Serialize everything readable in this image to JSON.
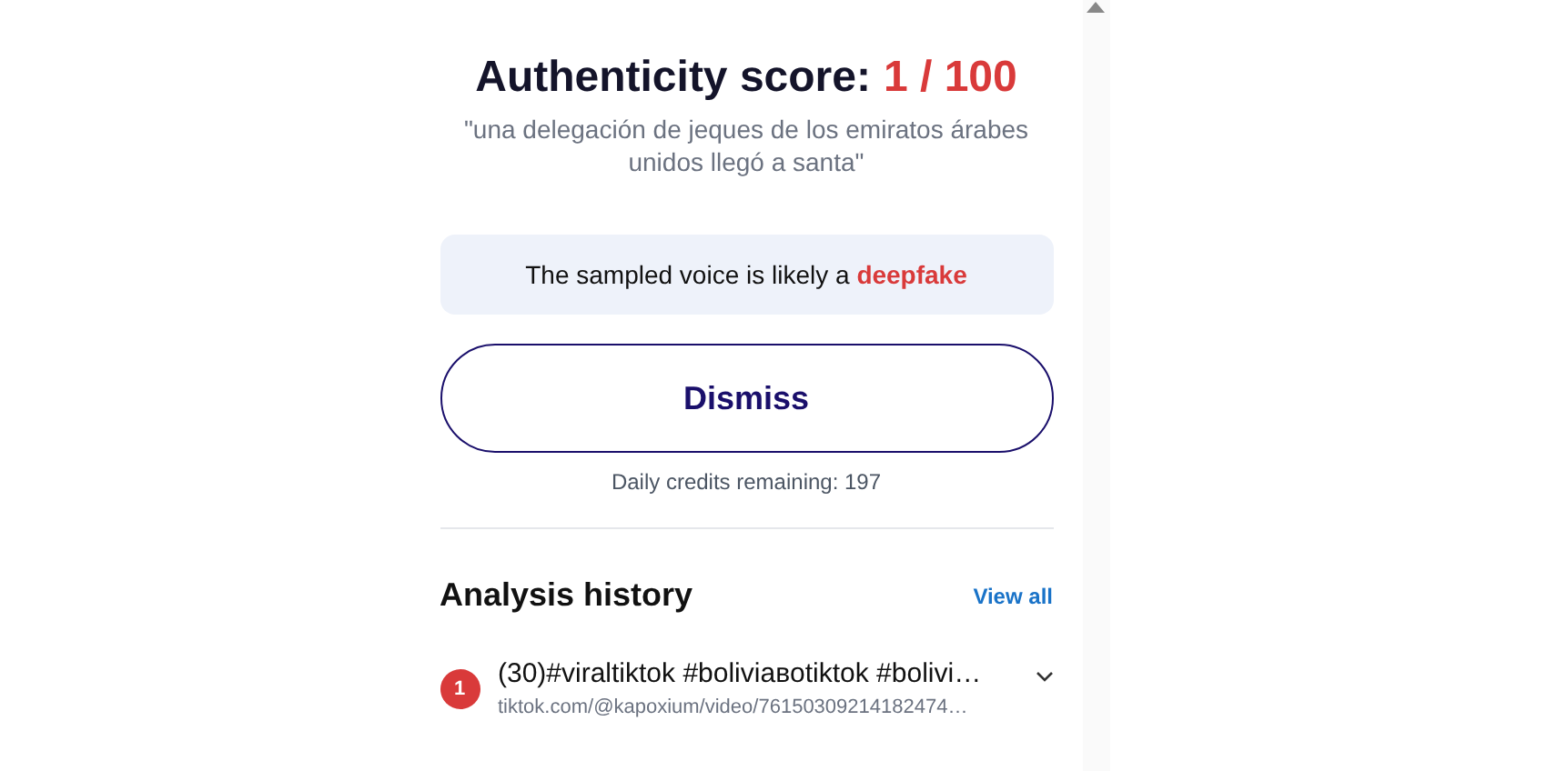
{
  "score": {
    "label": "Authenticity score:",
    "value": "1 / 100"
  },
  "quote": "\"una delegación de jeques de los emiratos árabes unidos llegó a santa\"",
  "verdict": "The sampled voice is likely a **deepfake**",
  "dismiss_button": "Dismiss",
  "credits": "Daily credits remaining: 197",
  "history": {
    "title": "Analysis history",
    "view_all": "View all",
    "items": [
      {
        "score": "1",
        "title": "(30)#viraltiktok #boliviaвotiktok #bolivi…",
        "url": "tiktok.com/@kapoxium/video/76150309214182474…",
        "expanded": false
      }
    ]
  }
}
